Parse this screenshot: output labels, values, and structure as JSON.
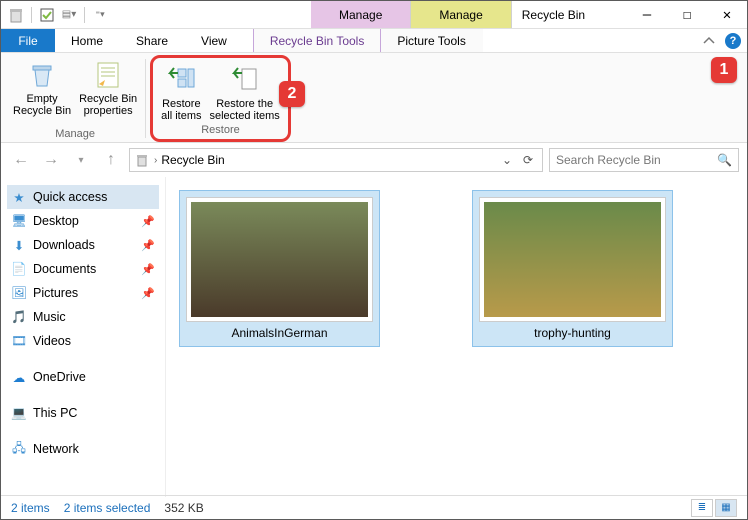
{
  "title": "Recycle Bin",
  "title_tabs": {
    "purple": "Manage",
    "yellow": "Manage"
  },
  "win": {
    "min": "—",
    "max": "☐",
    "close": "✕"
  },
  "menubar": {
    "file": "File",
    "items": [
      "Home",
      "Share",
      "View"
    ],
    "tool_tabs": [
      "Recycle Bin Tools",
      "Picture Tools"
    ],
    "help": "?"
  },
  "ribbon": {
    "manage": {
      "label": "Manage",
      "empty": "Empty\nRecycle Bin",
      "props": "Recycle Bin\nproperties"
    },
    "restore": {
      "label": "Restore",
      "all": "Restore\nall items",
      "selected": "Restore the\nselected items"
    }
  },
  "address": {
    "location": "Recycle Bin",
    "refresh_dropdown": "⌄",
    "refresh": "⟳"
  },
  "search": {
    "placeholder": "Search Recycle Bin"
  },
  "nav": {
    "quick": "Quick access",
    "desktop": "Desktop",
    "downloads": "Downloads",
    "documents": "Documents",
    "pictures": "Pictures",
    "music": "Music",
    "videos": "Videos",
    "onedrive": "OneDrive",
    "thispc": "This PC",
    "network": "Network"
  },
  "files": [
    {
      "name": "AnimalsInGerman"
    },
    {
      "name": "trophy-hunting"
    }
  ],
  "status": {
    "count": "2 items",
    "selected": "2 items selected",
    "size": "352 KB"
  },
  "annotations": {
    "one": "1",
    "two": "2"
  }
}
